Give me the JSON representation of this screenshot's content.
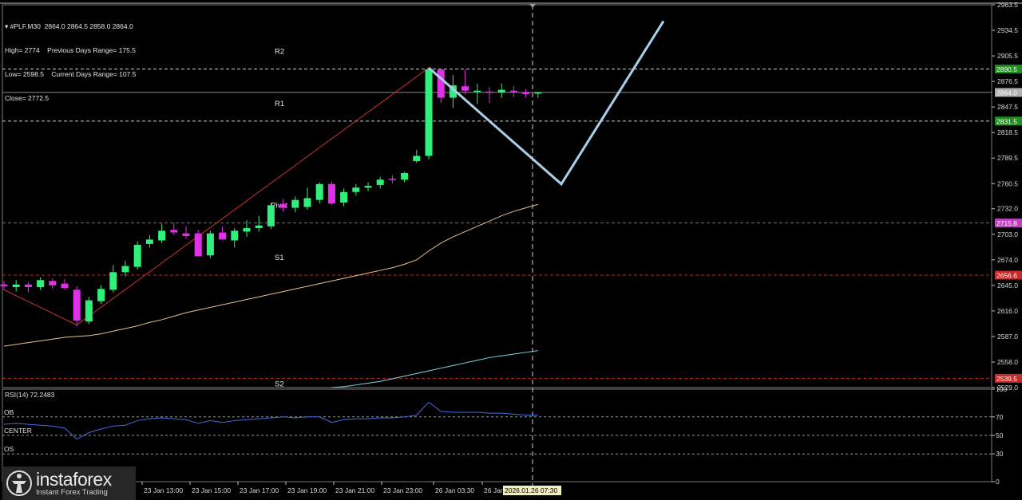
{
  "header": {
    "line1": "▾ #PLF.M30  2864.0 2864.5 2858.0 2864.0",
    "line2": "High= 2774    Previous Days Range= 175.5",
    "line3": "Low= 2598.5    Current Days Range= 107.5",
    "line4": "Close= 2772.5"
  },
  "logo": {
    "name": "instaforex",
    "tagline": "Instant Forex Trading"
  },
  "chart_data": {
    "type": "candlestick",
    "symbol": "#PLF.M30",
    "ylim": [
      2529.0,
      2963.5
    ],
    "price_ticks": [
      "2963.5",
      "2934.5",
      "2905.5",
      "2876.5",
      "2847.5",
      "2818.5",
      "2789.5",
      "2760.5",
      "2732.0",
      "2703.0",
      "2674.0",
      "2645.0",
      "2616.0",
      "2587.0",
      "2558.0",
      "2529.0"
    ],
    "levels": [
      {
        "label": "R2",
        "value": 2890.5,
        "price_label": "2890.5",
        "color": "#d0d0d0",
        "badge": "#1f8f1f"
      },
      {
        "label": "",
        "value": 2864.0,
        "price_label": "2864.0",
        "color": "#8a8a8a",
        "badge": "#b0b0b0"
      },
      {
        "label": "R1",
        "value": 2831.5,
        "price_label": "2831.5",
        "color": "#d0d0d0",
        "badge": "#1f8f1f"
      },
      {
        "label": "Pivot",
        "value": 2715.8,
        "price_label": "2715.8",
        "color": "#c040c0",
        "badge": "#c040c0"
      },
      {
        "label": "S1",
        "value": 2656.6,
        "price_label": "2656.6",
        "color": "#c82828",
        "badge": "#c82828"
      },
      {
        "label": "S2",
        "value": 2539.5,
        "price_label": "2539.5",
        "color": "#c82828",
        "badge": "#c82828"
      }
    ],
    "x_ticks": [
      "23 Jan 13:00",
      "23 Jan 15:00",
      "23 Jan 17:00",
      "23 Jan 19:00",
      "23 Jan 21:00",
      "23 Jan 23:00",
      "26 Jan 03:30",
      "26 Jan"
    ],
    "cursor_time": "2026.01.26 07:30",
    "candles": [
      {
        "o": 2646,
        "h": 2650,
        "l": 2640,
        "c": 2644
      },
      {
        "o": 2643,
        "h": 2651,
        "l": 2638,
        "c": 2646
      },
      {
        "o": 2646,
        "h": 2649,
        "l": 2637,
        "c": 2643
      },
      {
        "o": 2643,
        "h": 2654,
        "l": 2640,
        "c": 2651
      },
      {
        "o": 2650,
        "h": 2653,
        "l": 2641,
        "c": 2645
      },
      {
        "o": 2647,
        "h": 2652,
        "l": 2640,
        "c": 2642
      },
      {
        "o": 2640,
        "h": 2644,
        "l": 2598.5,
        "c": 2605
      },
      {
        "o": 2604,
        "h": 2632,
        "l": 2601,
        "c": 2628
      },
      {
        "o": 2627,
        "h": 2645,
        "l": 2624,
        "c": 2641
      },
      {
        "o": 2640,
        "h": 2668,
        "l": 2637,
        "c": 2660
      },
      {
        "o": 2660,
        "h": 2673,
        "l": 2655,
        "c": 2667
      },
      {
        "o": 2666,
        "h": 2695,
        "l": 2663,
        "c": 2691
      },
      {
        "o": 2692,
        "h": 2702,
        "l": 2688,
        "c": 2697
      },
      {
        "o": 2696,
        "h": 2715,
        "l": 2693,
        "c": 2707
      },
      {
        "o": 2708,
        "h": 2716,
        "l": 2702,
        "c": 2705
      },
      {
        "o": 2704,
        "h": 2712,
        "l": 2698,
        "c": 2701
      },
      {
        "o": 2704,
        "h": 2708,
        "l": 2682,
        "c": 2678
      },
      {
        "o": 2679,
        "h": 2707,
        "l": 2676,
        "c": 2704
      },
      {
        "o": 2705,
        "h": 2712,
        "l": 2698,
        "c": 2697
      },
      {
        "o": 2696,
        "h": 2710,
        "l": 2688,
        "c": 2707
      },
      {
        "o": 2706,
        "h": 2719,
        "l": 2700,
        "c": 2710
      },
      {
        "o": 2710,
        "h": 2724,
        "l": 2706,
        "c": 2713
      },
      {
        "o": 2712,
        "h": 2738,
        "l": 2709,
        "c": 2736
      },
      {
        "o": 2737,
        "h": 2743,
        "l": 2729,
        "c": 2733
      },
      {
        "o": 2733,
        "h": 2746,
        "l": 2728,
        "c": 2742
      },
      {
        "o": 2734,
        "h": 2756,
        "l": 2731,
        "c": 2744
      },
      {
        "o": 2742,
        "h": 2762,
        "l": 2738,
        "c": 2760
      },
      {
        "o": 2760,
        "h": 2763,
        "l": 2736,
        "c": 2738
      },
      {
        "o": 2739,
        "h": 2755,
        "l": 2735,
        "c": 2751
      },
      {
        "o": 2751,
        "h": 2760,
        "l": 2747,
        "c": 2756
      },
      {
        "o": 2756,
        "h": 2762,
        "l": 2752,
        "c": 2758
      },
      {
        "o": 2759,
        "h": 2768,
        "l": 2755,
        "c": 2765
      },
      {
        "o": 2766,
        "h": 2770,
        "l": 2761,
        "c": 2765
      },
      {
        "o": 2765,
        "h": 2774,
        "l": 2762,
        "c": 2772.5
      },
      {
        "o": 2786,
        "h": 2799,
        "l": 2784,
        "c": 2792
      },
      {
        "o": 2792,
        "h": 2892,
        "l": 2788,
        "c": 2890
      },
      {
        "o": 2890,
        "h": 2886,
        "l": 2852,
        "c": 2858
      },
      {
        "o": 2858,
        "h": 2884,
        "l": 2846,
        "c": 2872
      },
      {
        "o": 2871,
        "h": 2890,
        "l": 2862,
        "c": 2866
      },
      {
        "o": 2865,
        "h": 2874,
        "l": 2851,
        "c": 2866
      },
      {
        "o": 2865,
        "h": 2870,
        "l": 2852,
        "c": 2864
      },
      {
        "o": 2864,
        "h": 2874,
        "l": 2858,
        "c": 2867
      },
      {
        "o": 2866,
        "h": 2871,
        "l": 2859,
        "c": 2865
      },
      {
        "o": 2864,
        "h": 2868,
        "l": 2858,
        "c": 2862
      },
      {
        "o": 2864,
        "h": 2864.5,
        "l": 2858,
        "c": 2864
      }
    ],
    "ma_slow": [
      2576,
      2578,
      2580,
      2582,
      2584,
      2586,
      2587,
      2588,
      2590,
      2593,
      2596,
      2599,
      2603,
      2606,
      2610,
      2614,
      2617,
      2620,
      2623,
      2626,
      2629,
      2632,
      2635,
      2638,
      2641,
      2644,
      2647,
      2650,
      2653,
      2656,
      2659,
      2662,
      2665,
      2669,
      2674,
      2684,
      2693,
      2700,
      2706,
      2712,
      2718,
      2724,
      2729,
      2733,
      2737
    ],
    "ma_fast_start": 27,
    "ma_fast": [
      2529,
      2530,
      2532,
      2534,
      2536,
      2539,
      2542,
      2545,
      2548,
      2551,
      2554,
      2557,
      2560,
      2563,
      2565,
      2567,
      2569,
      2571
    ],
    "zigzag": [
      {
        "i": 0,
        "p": 2640
      },
      {
        "i": 6,
        "p": 2600
      },
      {
        "i": 35,
        "p": 2892
      }
    ],
    "forecast": [
      {
        "x": 2892,
        "t": 0
      },
      {
        "x": 2760,
        "t": 1
      },
      {
        "x": 2945,
        "t": 2
      }
    ],
    "rsi": {
      "label": "RSI(14) 72.2483",
      "value": 72.2483,
      "levels": [
        {
          "label": "OB",
          "value": 70
        },
        {
          "label": "CENTER",
          "value": 50
        },
        {
          "label": "OS",
          "value": 30
        }
      ],
      "ticks": [
        "100",
        "70",
        "50",
        "30",
        "0"
      ],
      "values": [
        62,
        63,
        62,
        61,
        60,
        58,
        46,
        53,
        57,
        60,
        61,
        66,
        68,
        69,
        68,
        67,
        63,
        66,
        64,
        66,
        67,
        68,
        69,
        70,
        69,
        70,
        70,
        64,
        67,
        68,
        68,
        69,
        69,
        70,
        72,
        86,
        76,
        75,
        75,
        75,
        74,
        74,
        73,
        72,
        72
      ]
    }
  }
}
